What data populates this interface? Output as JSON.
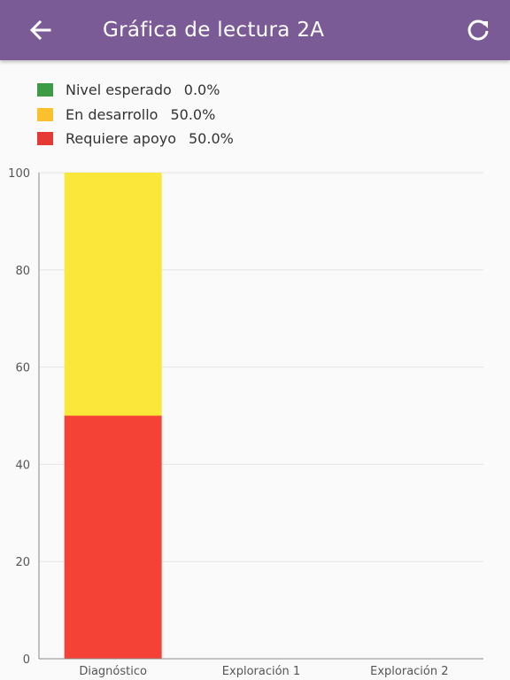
{
  "appbar": {
    "title": "Gráfica de lectura 2A",
    "back_icon": "arrow-left-icon",
    "refresh_icon": "refresh-icon"
  },
  "legend": [
    {
      "label": "Nivel esperado",
      "value": "0.0%",
      "color": "#3e9b45"
    },
    {
      "label": "En desarrollo",
      "value": "50.0%",
      "color": "#fbc02d"
    },
    {
      "label": "Requiere apoyo",
      "value": "50.0%",
      "color": "#e53935"
    }
  ],
  "colors": {
    "appbar": "#7b5b95",
    "bar_yellow": "#fbe73a",
    "bar_red": "#f44336",
    "grid": "#e4e4e4"
  },
  "chart_data": {
    "type": "bar",
    "stacked": true,
    "categories": [
      "Diagnóstico",
      "Exploración 1",
      "Exploración 2"
    ],
    "series": [
      {
        "name": "Requiere apoyo",
        "values": [
          50,
          0,
          0
        ],
        "color": "#f44336"
      },
      {
        "name": "En desarrollo",
        "values": [
          50,
          0,
          0
        ],
        "color": "#fbe73a"
      },
      {
        "name": "Nivel esperado",
        "values": [
          0,
          0,
          0
        ],
        "color": "#3e9b45"
      }
    ],
    "ylim": [
      0,
      100
    ],
    "yticks": [
      0,
      20,
      40,
      60,
      80,
      100
    ],
    "grid": true,
    "legend": "top-left"
  }
}
